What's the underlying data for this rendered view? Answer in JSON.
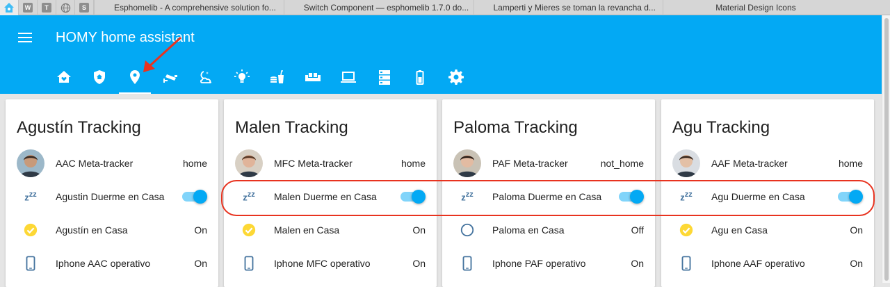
{
  "browser": {
    "pinned_tabs": [
      {
        "icon": "home-assistant-icon",
        "letter": ""
      },
      {
        "icon": "w-icon",
        "letter": "W"
      },
      {
        "icon": "t-icon",
        "letter": "T"
      },
      {
        "icon": "globe-icon",
        "letter": ""
      },
      {
        "icon": "s-icon",
        "letter": "S"
      }
    ],
    "tabs": [
      {
        "title": "Esphomelib - A comprehensive solution fo..."
      },
      {
        "title": "Switch Component — esphomelib 1.7.0 do..."
      },
      {
        "title": "Lamperti y Mieres se toman la revancha d..."
      },
      {
        "title": "Material Design Icons"
      }
    ]
  },
  "header": {
    "title": "HOMY home assistant",
    "menu_icon": "menu-icon",
    "accent_color": "#03a9f4",
    "view_tabs": [
      {
        "icon": "home-heart-icon"
      },
      {
        "icon": "shield-home-icon"
      },
      {
        "icon": "map-marker-icon",
        "selected": true
      },
      {
        "icon": "cctv-icon"
      },
      {
        "icon": "weather-night-partly-cloudy-icon"
      },
      {
        "icon": "lightbulb-on-icon"
      },
      {
        "icon": "food-drink-icon"
      },
      {
        "icon": "sofa-icon"
      },
      {
        "icon": "laptop-icon"
      },
      {
        "icon": "server-icon"
      },
      {
        "icon": "battery-icon"
      },
      {
        "icon": "settings-gear-icon"
      }
    ]
  },
  "cards": [
    {
      "title": "Agustín Tracking",
      "tracker": {
        "name": "AAC Meta-tracker",
        "state": "home"
      },
      "sleep": {
        "name": "Agustin Duerme en Casa",
        "on": true
      },
      "presence": {
        "name": "Agustín en Casa",
        "state": "On",
        "icon": "check-circle-icon"
      },
      "phone": {
        "name": "Iphone AAC operativo",
        "state": "On",
        "icon": "cellphone-icon"
      }
    },
    {
      "title": "Malen Tracking",
      "tracker": {
        "name": "MFC Meta-tracker",
        "state": "home"
      },
      "sleep": {
        "name": "Malen Duerme en Casa",
        "on": true
      },
      "presence": {
        "name": "Malen en Casa",
        "state": "On",
        "icon": "check-circle-icon"
      },
      "phone": {
        "name": "Iphone MFC operativo",
        "state": "On",
        "icon": "cellphone-icon"
      }
    },
    {
      "title": "Paloma Tracking",
      "tracker": {
        "name": "PAF Meta-tracker",
        "state": "not_home"
      },
      "sleep": {
        "name": "Paloma Duerme en Casa",
        "on": true
      },
      "presence": {
        "name": "Paloma en Casa",
        "state": "Off",
        "icon": "circle-outline-icon"
      },
      "phone": {
        "name": "Iphone PAF operativo",
        "state": "On",
        "icon": "cellphone-icon"
      }
    },
    {
      "title": "Agu Tracking",
      "tracker": {
        "name": "AAF Meta-tracker",
        "state": "home"
      },
      "sleep": {
        "name": "Agu Duerme en Casa",
        "on": true
      },
      "presence": {
        "name": "Agu en Casa",
        "state": "On",
        "icon": "check-circle-icon"
      },
      "phone": {
        "name": "Iphone AAF operativo",
        "state": "On",
        "icon": "cellphone-icon"
      }
    }
  ],
  "annotations": {
    "highlight_color": "#e8331f",
    "arrow_target": "map-marker-icon"
  }
}
